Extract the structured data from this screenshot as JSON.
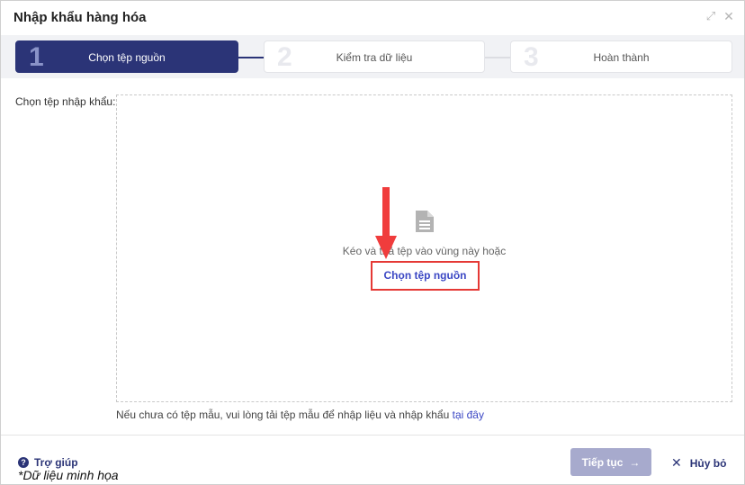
{
  "dialog": {
    "title": "Nhập khẩu hàng hóa",
    "expand_icon": "⤢",
    "close_icon": "✕"
  },
  "steps": [
    {
      "number": "1",
      "label": "Chọn tệp nguồn",
      "active": true
    },
    {
      "number": "2",
      "label": "Kiểm tra dữ liệu",
      "active": false
    },
    {
      "number": "3",
      "label": "Hoàn thành",
      "active": false
    }
  ],
  "upload": {
    "field_label": "Chọn tệp nhập khẩu:",
    "drop_text": "Kéo và thả tệp vào vùng này hoặc",
    "choose_button": "Chọn tệp nguồn",
    "hint_text": "Nếu chưa có tệp mẫu, vui lòng tải tệp mẫu để nhập liệu và nhập khẩu ",
    "hint_link": "tại đây"
  },
  "footer": {
    "help_label": "Trợ giúp",
    "note": "*Dữ liệu minh họa",
    "next_button": "Tiếp tục",
    "next_arrow": "→",
    "cancel_button": "Hủy bỏ",
    "cancel_icon": "✕"
  },
  "colors": {
    "primary": "#2b3477",
    "link": "#3b47c4",
    "highlight_red": "#e53935",
    "disabled_button": "#a7aacd"
  }
}
